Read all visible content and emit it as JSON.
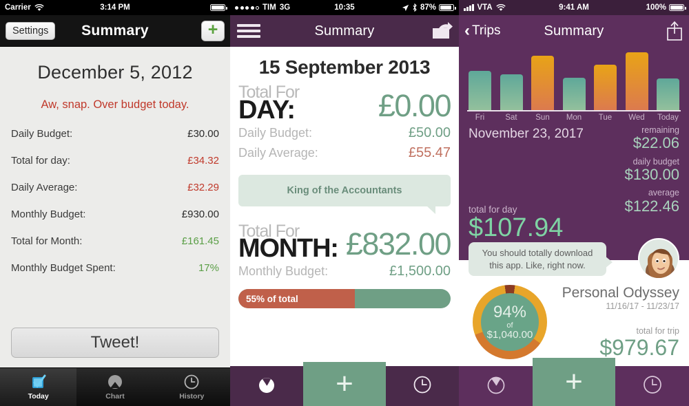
{
  "panel1": {
    "status": {
      "carrier": "Carrier",
      "time": "3:14 PM",
      "wifi_icon": "wifi-icon",
      "battery_icon": "battery-full-icon"
    },
    "nav": {
      "settings_label": "Settings",
      "title": "Summary",
      "add_label": "+"
    },
    "date": "December 5, 2012",
    "warning": "Aw, snap. Over budget today.",
    "rows": [
      {
        "label": "Daily Budget:",
        "value": "£30.00",
        "state": "neutral"
      },
      {
        "label": "Total for day:",
        "value": "£34.32",
        "state": "over"
      },
      {
        "label": "Daily Average:",
        "value": "£32.29",
        "state": "over"
      },
      {
        "label": "Monthly Budget:",
        "value": "£930.00",
        "state": "neutral"
      },
      {
        "label": "Total for Month:",
        "value": "£161.45",
        "state": "good"
      },
      {
        "label": "Monthly Budget Spent:",
        "value": "17%",
        "state": "good"
      }
    ],
    "tweet_label": "Tweet!",
    "tabs": [
      {
        "label": "Today",
        "icon": "checkbox-icon",
        "active": true
      },
      {
        "label": "Chart",
        "icon": "chart-icon",
        "active": false
      },
      {
        "label": "History",
        "icon": "clock-icon",
        "active": false
      }
    ]
  },
  "panel2": {
    "status": {
      "carrier": "TIM",
      "network": "3G",
      "time": "10:35",
      "location_icon": "location-arrow-icon",
      "bluetooth_icon": "bluetooth-icon",
      "battery_pct": "87%"
    },
    "nav": {
      "menu_icon": "hamburger-menu-icon",
      "title": "Summary",
      "share_icon": "share-icon"
    },
    "date": "15 September 2013",
    "day_block": {
      "small_label": "Total For",
      "big_label": "DAY:",
      "amount": "£0.00"
    },
    "day_rows": [
      {
        "label": "Daily Budget:",
        "value": "£50.00",
        "state": "good"
      },
      {
        "label": "Daily Average:",
        "value": "£55.47",
        "state": "over"
      }
    ],
    "badge": "King of the Accountants",
    "month_block": {
      "small_label": "Total For",
      "big_label": "MONTH:",
      "amount": "£832.00"
    },
    "month_rows": [
      {
        "label": "Monthly Budget:",
        "value": "£1,500.00",
        "state": "good"
      }
    ],
    "progress": {
      "label": "55% of total",
      "percent": 55
    },
    "tabs": [
      {
        "icon": "clock-filled-icon"
      },
      {
        "icon": "plus-icon",
        "label": "+"
      },
      {
        "icon": "clock-outline-icon"
      }
    ]
  },
  "panel3": {
    "status": {
      "carrier": "VTA",
      "time": "9:41 AM",
      "battery_pct": "100%",
      "signal_icon": "signal-bars-icon",
      "wifi_icon": "wifi-icon",
      "battery_icon": "battery-full-icon"
    },
    "nav": {
      "back_label": "Trips",
      "back_icon": "chevron-left-icon",
      "title": "Summary",
      "share_icon": "share-up-icon"
    },
    "date": "November 23, 2017",
    "stats": [
      {
        "label": "remaining",
        "value": "$22.06"
      },
      {
        "label": "daily budget",
        "value": "$130.00"
      },
      {
        "label": "average",
        "value": "$122.46"
      }
    ],
    "total_for_day": {
      "label": "total for day",
      "value": "$107.94"
    },
    "speech": "You should totally download this app. Like, right now.",
    "avatar_icon": "avatar-woman-icon",
    "donut": {
      "percent": "94%",
      "of_label": "of",
      "amount": "$1,040.00"
    },
    "trip": {
      "name": "Personal Odyssey",
      "range": "11/16/17 - 11/23/17",
      "total_label": "total for trip",
      "total_value": "$979.67"
    },
    "tabs": [
      {
        "icon": "clock-filled-icon"
      },
      {
        "icon": "plus-icon",
        "label": "+"
      },
      {
        "icon": "clock-outline-icon"
      }
    ],
    "chart_data": {
      "type": "bar",
      "categories": [
        "Fri",
        "Sat",
        "Sun",
        "Mon",
        "Tue",
        "Wed",
        "Today"
      ],
      "values": [
        62,
        57,
        86,
        52,
        72,
        92,
        50
      ],
      "colors": [
        "teal",
        "teal",
        "orange",
        "teal",
        "orange",
        "orange",
        "teal"
      ],
      "title": "",
      "xlabel": "",
      "ylabel": "",
      "ylim": [
        0,
        100
      ],
      "grid": false,
      "legend": "none"
    }
  },
  "colors": {
    "purple_dark": "#3b1f3b",
    "purple_nav": "#4a2a4a",
    "purple_body": "#5d2f5d",
    "green_accent": "#6f9f85",
    "green_bright": "#7fd3a4",
    "red_accent": "#c0392b",
    "orange_bar": "#e8a317",
    "teal_bar": "#5fa899"
  }
}
